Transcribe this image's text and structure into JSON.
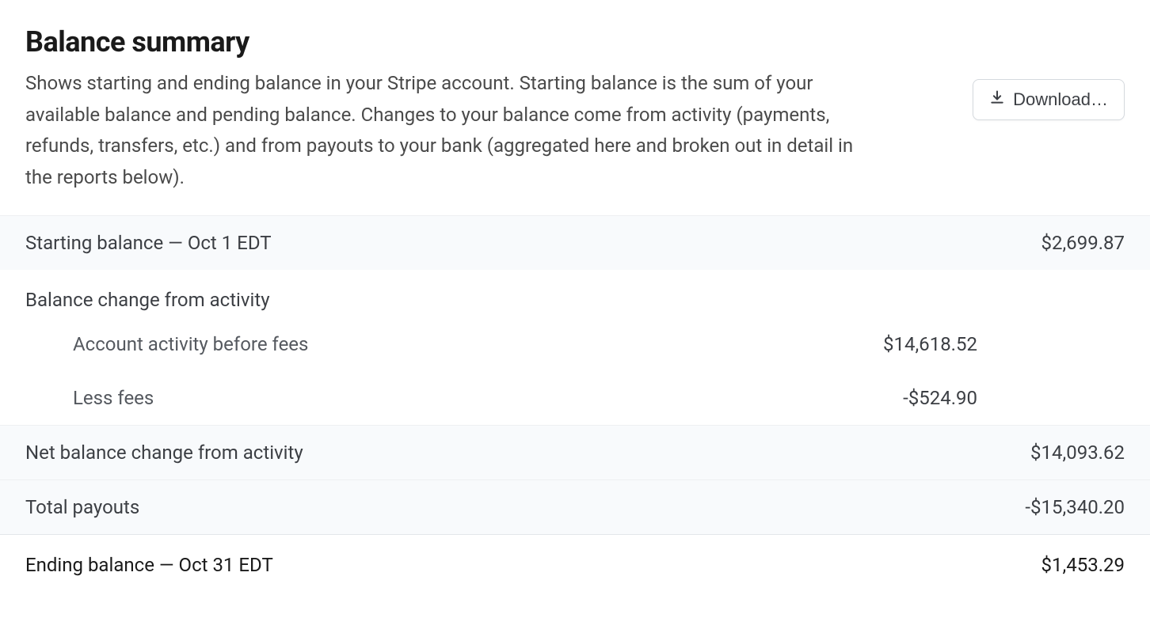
{
  "header": {
    "title": "Balance summary",
    "description": "Shows starting and ending balance in your Stripe account. Starting balance is the sum of your available balance and pending balance. Changes to your balance come from activity (payments, refunds, transfers, etc.) and from payouts to your bank (aggregated here and broken out in detail in the reports below).",
    "download_label": "Download…"
  },
  "rows": {
    "starting": {
      "label": "Starting balance — Oct 1 EDT",
      "value": "$2,699.87"
    },
    "activity_section_label": "Balance change from activity",
    "activity_before_fees": {
      "label": "Account activity before fees",
      "value": "$14,618.52"
    },
    "less_fees": {
      "label": "Less fees",
      "value": "-$524.90"
    },
    "net_change": {
      "label": "Net balance change from activity",
      "value": "$14,093.62"
    },
    "total_payouts": {
      "label": "Total payouts",
      "value": "-$15,340.20"
    },
    "ending": {
      "label": "Ending balance — Oct 31 EDT",
      "value": "$1,453.29"
    }
  }
}
